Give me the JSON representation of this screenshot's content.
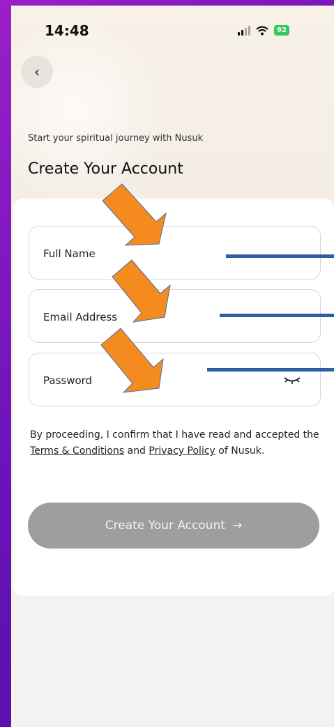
{
  "status_bar": {
    "time": "14:48",
    "battery": "92"
  },
  "header": {
    "subtitle": "Start your spiritual journey with Nusuk",
    "title": "Create Your Account"
  },
  "form": {
    "full_name_label": "Full Name",
    "email_label": "Email Address",
    "password_label": "Password"
  },
  "terms": {
    "prefix": "By proceeding, I confirm that I have read and accepted the",
    "terms_link": "Terms & Conditions",
    "and": "and",
    "privacy_link": "Privacy Policy",
    "suffix": "of Nusuk."
  },
  "submit": {
    "label": "Create Your Account",
    "arrow": "→"
  },
  "colors": {
    "frame": "#7a16bc",
    "arrow_annotation": "#f58a1f",
    "line_annotation": "#2f5fa3",
    "button_disabled": "#9e9e9e"
  },
  "icons": [
    "back-chevron-icon",
    "signal-icon",
    "wifi-icon",
    "battery-icon",
    "eye-closed-icon",
    "arrow-right-icon"
  ]
}
